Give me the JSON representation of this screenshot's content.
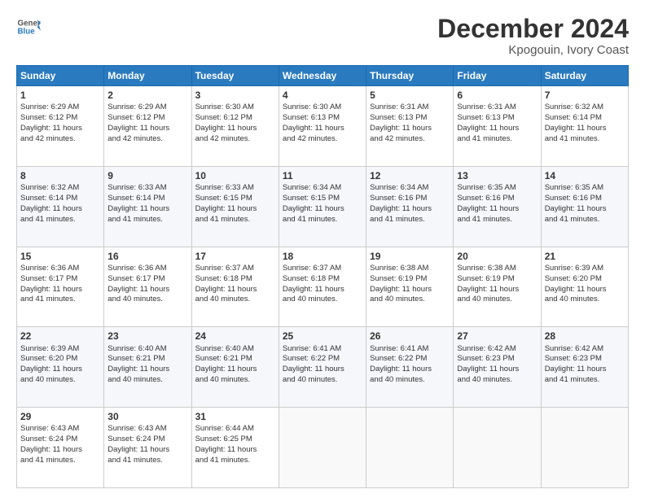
{
  "header": {
    "logo_line1": "General",
    "logo_line2": "Blue",
    "title": "December 2024",
    "subtitle": "Kpogouin, Ivory Coast"
  },
  "calendar": {
    "days_of_week": [
      "Sunday",
      "Monday",
      "Tuesday",
      "Wednesday",
      "Thursday",
      "Friday",
      "Saturday"
    ],
    "weeks": [
      [
        {
          "day": "1",
          "lines": [
            "Sunrise: 6:29 AM",
            "Sunset: 6:12 PM",
            "Daylight: 11 hours",
            "and 42 minutes."
          ]
        },
        {
          "day": "2",
          "lines": [
            "Sunrise: 6:29 AM",
            "Sunset: 6:12 PM",
            "Daylight: 11 hours",
            "and 42 minutes."
          ]
        },
        {
          "day": "3",
          "lines": [
            "Sunrise: 6:30 AM",
            "Sunset: 6:12 PM",
            "Daylight: 11 hours",
            "and 42 minutes."
          ]
        },
        {
          "day": "4",
          "lines": [
            "Sunrise: 6:30 AM",
            "Sunset: 6:13 PM",
            "Daylight: 11 hours",
            "and 42 minutes."
          ]
        },
        {
          "day": "5",
          "lines": [
            "Sunrise: 6:31 AM",
            "Sunset: 6:13 PM",
            "Daylight: 11 hours",
            "and 42 minutes."
          ]
        },
        {
          "day": "6",
          "lines": [
            "Sunrise: 6:31 AM",
            "Sunset: 6:13 PM",
            "Daylight: 11 hours",
            "and 41 minutes."
          ]
        },
        {
          "day": "7",
          "lines": [
            "Sunrise: 6:32 AM",
            "Sunset: 6:14 PM",
            "Daylight: 11 hours",
            "and 41 minutes."
          ]
        }
      ],
      [
        {
          "day": "8",
          "lines": [
            "Sunrise: 6:32 AM",
            "Sunset: 6:14 PM",
            "Daylight: 11 hours",
            "and 41 minutes."
          ]
        },
        {
          "day": "9",
          "lines": [
            "Sunrise: 6:33 AM",
            "Sunset: 6:14 PM",
            "Daylight: 11 hours",
            "and 41 minutes."
          ]
        },
        {
          "day": "10",
          "lines": [
            "Sunrise: 6:33 AM",
            "Sunset: 6:15 PM",
            "Daylight: 11 hours",
            "and 41 minutes."
          ]
        },
        {
          "day": "11",
          "lines": [
            "Sunrise: 6:34 AM",
            "Sunset: 6:15 PM",
            "Daylight: 11 hours",
            "and 41 minutes."
          ]
        },
        {
          "day": "12",
          "lines": [
            "Sunrise: 6:34 AM",
            "Sunset: 6:16 PM",
            "Daylight: 11 hours",
            "and 41 minutes."
          ]
        },
        {
          "day": "13",
          "lines": [
            "Sunrise: 6:35 AM",
            "Sunset: 6:16 PM",
            "Daylight: 11 hours",
            "and 41 minutes."
          ]
        },
        {
          "day": "14",
          "lines": [
            "Sunrise: 6:35 AM",
            "Sunset: 6:16 PM",
            "Daylight: 11 hours",
            "and 41 minutes."
          ]
        }
      ],
      [
        {
          "day": "15",
          "lines": [
            "Sunrise: 6:36 AM",
            "Sunset: 6:17 PM",
            "Daylight: 11 hours",
            "and 41 minutes."
          ]
        },
        {
          "day": "16",
          "lines": [
            "Sunrise: 6:36 AM",
            "Sunset: 6:17 PM",
            "Daylight: 11 hours",
            "and 40 minutes."
          ]
        },
        {
          "day": "17",
          "lines": [
            "Sunrise: 6:37 AM",
            "Sunset: 6:18 PM",
            "Daylight: 11 hours",
            "and 40 minutes."
          ]
        },
        {
          "day": "18",
          "lines": [
            "Sunrise: 6:37 AM",
            "Sunset: 6:18 PM",
            "Daylight: 11 hours",
            "and 40 minutes."
          ]
        },
        {
          "day": "19",
          "lines": [
            "Sunrise: 6:38 AM",
            "Sunset: 6:19 PM",
            "Daylight: 11 hours",
            "and 40 minutes."
          ]
        },
        {
          "day": "20",
          "lines": [
            "Sunrise: 6:38 AM",
            "Sunset: 6:19 PM",
            "Daylight: 11 hours",
            "and 40 minutes."
          ]
        },
        {
          "day": "21",
          "lines": [
            "Sunrise: 6:39 AM",
            "Sunset: 6:20 PM",
            "Daylight: 11 hours",
            "and 40 minutes."
          ]
        }
      ],
      [
        {
          "day": "22",
          "lines": [
            "Sunrise: 6:39 AM",
            "Sunset: 6:20 PM",
            "Daylight: 11 hours",
            "and 40 minutes."
          ]
        },
        {
          "day": "23",
          "lines": [
            "Sunrise: 6:40 AM",
            "Sunset: 6:21 PM",
            "Daylight: 11 hours",
            "and 40 minutes."
          ]
        },
        {
          "day": "24",
          "lines": [
            "Sunrise: 6:40 AM",
            "Sunset: 6:21 PM",
            "Daylight: 11 hours",
            "and 40 minutes."
          ]
        },
        {
          "day": "25",
          "lines": [
            "Sunrise: 6:41 AM",
            "Sunset: 6:22 PM",
            "Daylight: 11 hours",
            "and 40 minutes."
          ]
        },
        {
          "day": "26",
          "lines": [
            "Sunrise: 6:41 AM",
            "Sunset: 6:22 PM",
            "Daylight: 11 hours",
            "and 40 minutes."
          ]
        },
        {
          "day": "27",
          "lines": [
            "Sunrise: 6:42 AM",
            "Sunset: 6:23 PM",
            "Daylight: 11 hours",
            "and 40 minutes."
          ]
        },
        {
          "day": "28",
          "lines": [
            "Sunrise: 6:42 AM",
            "Sunset: 6:23 PM",
            "Daylight: 11 hours",
            "and 41 minutes."
          ]
        }
      ],
      [
        {
          "day": "29",
          "lines": [
            "Sunrise: 6:43 AM",
            "Sunset: 6:24 PM",
            "Daylight: 11 hours",
            "and 41 minutes."
          ]
        },
        {
          "day": "30",
          "lines": [
            "Sunrise: 6:43 AM",
            "Sunset: 6:24 PM",
            "Daylight: 11 hours",
            "and 41 minutes."
          ]
        },
        {
          "day": "31",
          "lines": [
            "Sunrise: 6:44 AM",
            "Sunset: 6:25 PM",
            "Daylight: 11 hours",
            "and 41 minutes."
          ]
        },
        {
          "day": "",
          "lines": []
        },
        {
          "day": "",
          "lines": []
        },
        {
          "day": "",
          "lines": []
        },
        {
          "day": "",
          "lines": []
        }
      ]
    ]
  }
}
